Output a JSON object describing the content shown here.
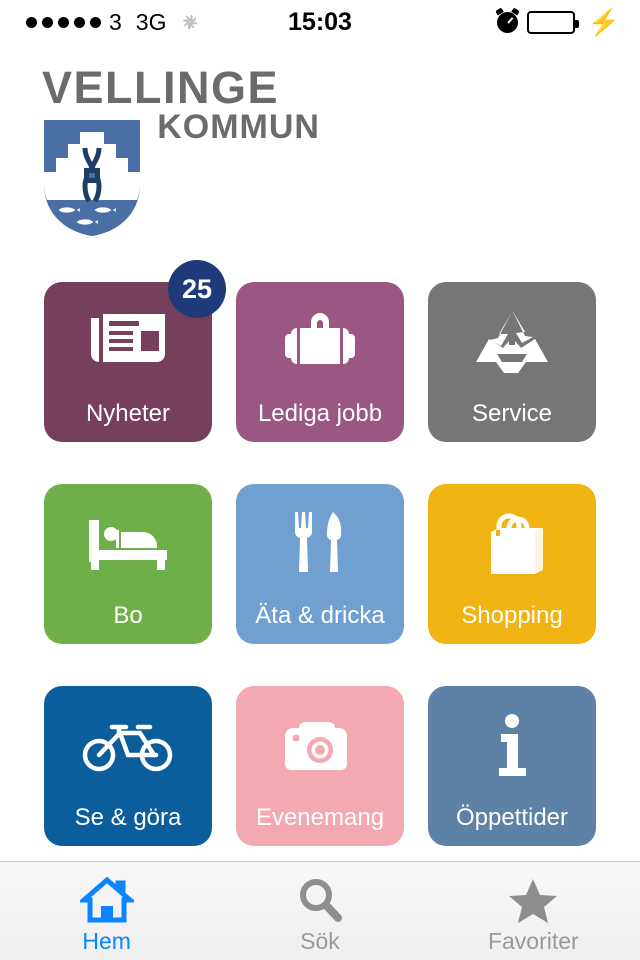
{
  "status_bar": {
    "signal_dots": 5,
    "carrier": "3",
    "network": "3G",
    "activity_icon": "activity-spinner-icon",
    "time": "15:03",
    "alarm_icon": "alarm-clock-icon",
    "battery_icon": "battery-full-icon",
    "battery_color": "#4CD964",
    "charging_icon": "lightning-bolt-icon"
  },
  "logo": {
    "line1": "VELLINGE",
    "line2": "KOMMUN",
    "text_color": "#6b6b6b",
    "crest_icon": "vellinge-coat-of-arms-icon",
    "crest_blue": "#4A6FA5",
    "crest_dark_blue": "#1F3E66"
  },
  "tiles": [
    {
      "label": "Nyheter",
      "color": "#76405D",
      "icon": "newspaper-icon",
      "badge": "25",
      "badge_color": "#1F3A7A"
    },
    {
      "label": "Lediga jobb",
      "color": "#9A5782",
      "icon": "briefcase-icon",
      "badge": null
    },
    {
      "label": "Service",
      "color": "#767676",
      "icon": "recycling-icon",
      "badge": null
    },
    {
      "label": "Bo",
      "color": "#6FAF4A",
      "icon": "bed-icon",
      "badge": null
    },
    {
      "label": "Äta & dricka",
      "color": "#71A0D0",
      "icon": "fork-knife-icon",
      "badge": null
    },
    {
      "label": "Shopping",
      "color": "#EFB411",
      "icon": "shopping-bag-icon",
      "badge": null
    },
    {
      "label": "Se & göra",
      "color": "#0B5E9B",
      "icon": "bicycle-icon",
      "badge": null
    },
    {
      "label": "Evenemang",
      "color": "#F4A8B0",
      "icon": "camera-icon",
      "badge": null
    },
    {
      "label": "Öppettider",
      "color": "#5D82A6",
      "icon": "info-icon",
      "badge": null
    }
  ],
  "tab_bar": {
    "active_color": "#0a84ff",
    "idle_color": "#9a9a9a",
    "items": [
      {
        "label": "Hem",
        "icon": "home-icon",
        "active": true
      },
      {
        "label": "Sök",
        "icon": "search-icon",
        "active": false
      },
      {
        "label": "Favoriter",
        "icon": "star-icon",
        "active": false
      }
    ]
  }
}
